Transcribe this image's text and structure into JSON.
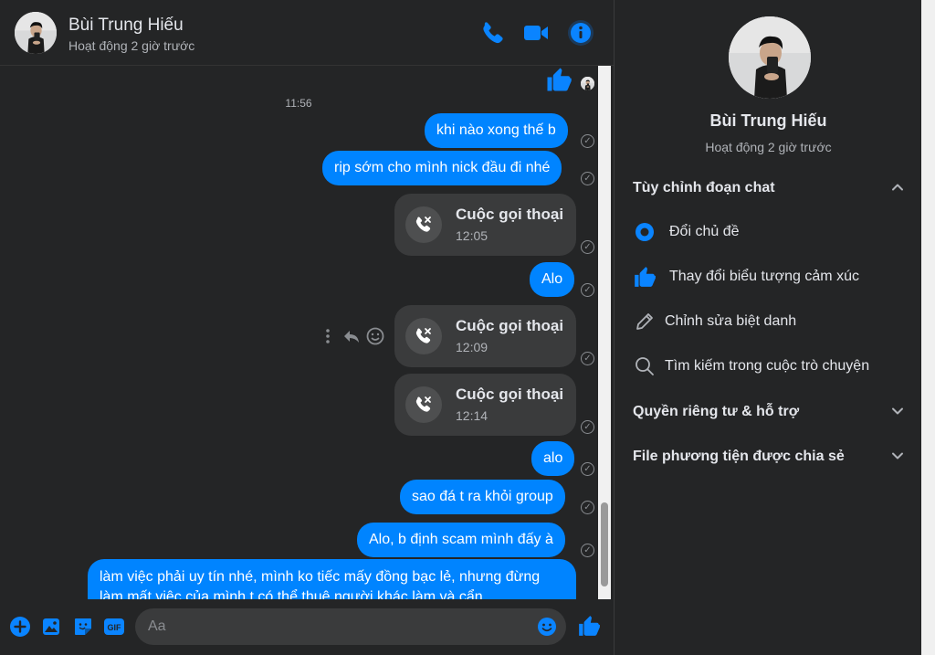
{
  "contact": {
    "name": "Bùi Trung Hiếu",
    "status": "Hoạt động 2 giờ trước"
  },
  "header_icons": [
    "phone-icon",
    "video-icon",
    "info-icon"
  ],
  "colors": {
    "accent": "#0084ff",
    "background": "#242526",
    "bubble_other": "#3a3b3c"
  },
  "messages": {
    "time_separator": "11:56",
    "m1": "khi nào xong thế b",
    "m2": "rip sớm cho mình nick đầu đi nhé",
    "call1": {
      "title": "Cuộc gọi thoại",
      "time": "12:05"
    },
    "m3": "Alo",
    "call2": {
      "title": "Cuộc gọi thoại",
      "time": "12:09"
    },
    "call3": {
      "title": "Cuộc gọi thoại",
      "time": "12:14"
    },
    "m4": "alo",
    "m5": "sao đá t ra khỏi group",
    "m6": "Alo, b định scam mình đấy à",
    "m7": "làm việc phải uy tín nhé, mình ko tiếc mấy đồng bạc lẻ, nhưng đừng làm mất việc của mình t có thể thuê người khác làm và cẩn"
  },
  "composer": {
    "placeholder": "Aa",
    "icons": [
      "plus-icon",
      "image-icon",
      "sticker-icon",
      "gif-icon",
      "emoji-icon",
      "like-icon"
    ],
    "gif_label": "GIF"
  },
  "info_panel": {
    "customize_section": "Tùy chỉnh đoạn chat",
    "options": [
      {
        "label": "Đổi chủ đề",
        "icon": "theme-icon"
      },
      {
        "label": "Thay đổi biểu tượng cảm xúc",
        "icon": "like-icon"
      },
      {
        "label": "Chỉnh sửa biệt danh",
        "icon": "pencil-icon"
      },
      {
        "label": "Tìm kiếm trong cuộc trò chuyện",
        "icon": "search-icon"
      }
    ],
    "privacy_section": "Quyền riêng tư & hỗ trợ",
    "media_section": "File phương tiện được chia sẻ"
  }
}
